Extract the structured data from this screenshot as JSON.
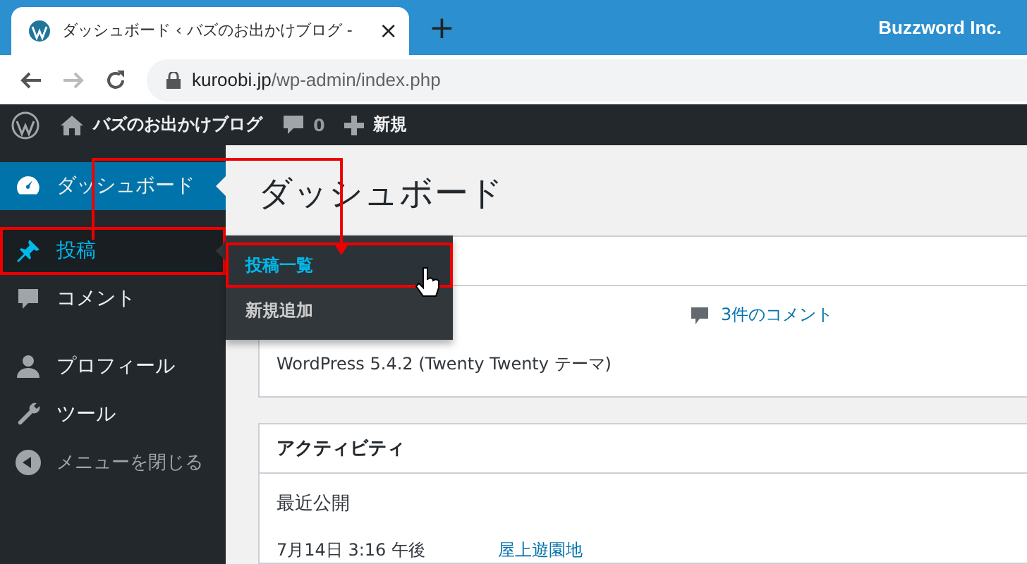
{
  "browser": {
    "tab_title": "ダッシュボード ‹ バズのお出かけブログ -",
    "close": "×",
    "new_tab": "+",
    "profile": "Buzzword Inc.",
    "url_host": "kuroobi.jp",
    "url_path": "/wp-admin/index.php"
  },
  "admin_bar": {
    "site": "バズのお出かけブログ",
    "comments": "0",
    "new": "新規"
  },
  "sidebar": [
    {
      "kind": "dashboard",
      "label": "ダッシュボード",
      "selected": true,
      "hovered": false,
      "annotated": false
    },
    {
      "kind": "posts",
      "label": "投稿",
      "selected": false,
      "hovered": true,
      "annotated": true
    },
    {
      "kind": "comments",
      "label": "コメント",
      "selected": false,
      "hovered": false,
      "annotated": false
    },
    {
      "kind": "profile",
      "label": "プロフィール",
      "selected": false,
      "hovered": false,
      "annotated": false
    },
    {
      "kind": "tools",
      "label": "ツール",
      "selected": false,
      "hovered": false,
      "annotated": false
    },
    {
      "kind": "collapse",
      "label": "メニューを閉じる",
      "selected": false,
      "hovered": false,
      "annotated": false
    }
  ],
  "flyout": [
    {
      "label": "投稿一覧",
      "selected": true,
      "annotated": true
    },
    {
      "label": "新規追加",
      "selected": false,
      "annotated": false
    }
  ],
  "page_title": "ダッシュボード",
  "glance": {
    "comments": "3件のコメント",
    "version": "WordPress 5.4.2 (Twenty Twenty テーマ)"
  },
  "activity": {
    "title": "アクティビティ",
    "section": "最近公開",
    "rows": [
      {
        "date": "7月14日 3:16 午後",
        "post": "屋上遊園地"
      }
    ]
  }
}
